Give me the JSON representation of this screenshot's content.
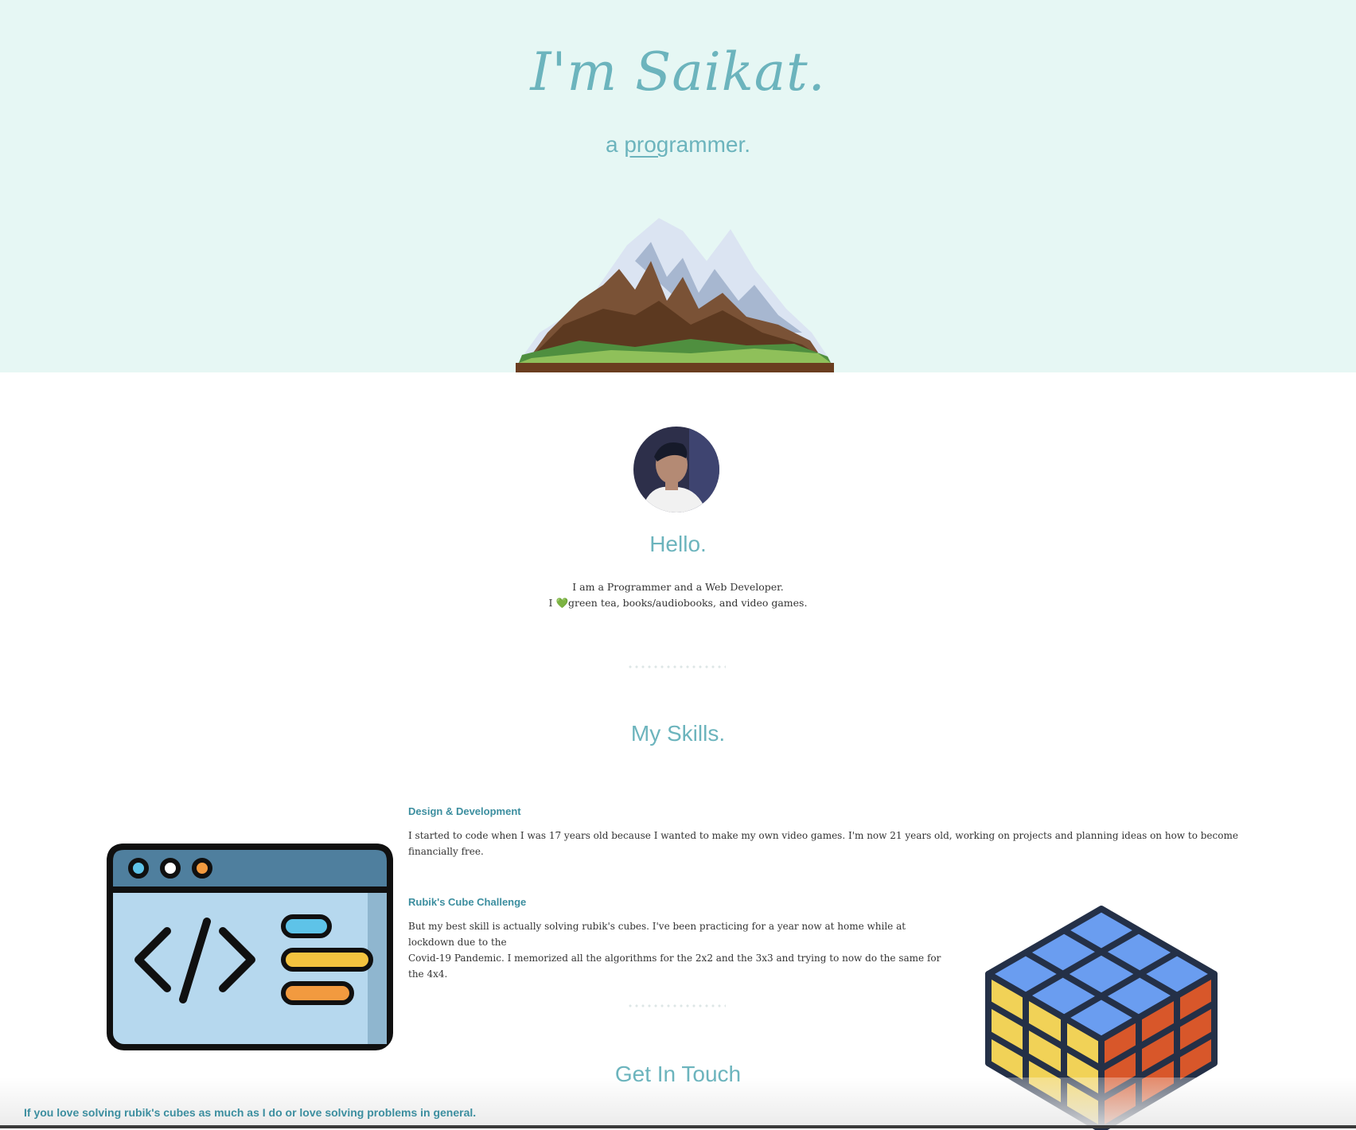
{
  "hero": {
    "title": "I'm Saikat.",
    "subtitle_prefix": "a ",
    "subtitle_underlined": "prog",
    "subtitle_rest": "rammer."
  },
  "about": {
    "heading": "Hello.",
    "line1": "I am a Programmer and a Web Developer.",
    "line2_prefix": "I ",
    "heart": "💚",
    "line2_rest": "green tea, books/audiobooks, and video games."
  },
  "skills": {
    "heading": "My Skills.",
    "items": [
      {
        "title": "Design & Development",
        "text": "I started to code when I was 17 years old because I wanted to make my own video games. I'm now 21 years old, working on projects and planning ideas on how to become financially free."
      },
      {
        "title": "Rubik's Cube Challenge",
        "text_line1": "But my best skill is actually solving rubik's cubes. I've been practicing for a year now at home while at lockdown due to the",
        "text_line2": "Covid-19 Pandemic. I memorized all the algorithms for the 2x2 and the 3x3 and trying to now do the same for the 4x4."
      }
    ]
  },
  "contact": {
    "heading": "Get In Touch",
    "footer_text": "If you love solving rubik's cubes as much as I do or love solving problems in general."
  },
  "icons": {
    "mountain": "mountain-illustration",
    "avatar": "avatar-photo",
    "code": "code-window-icon",
    "cube": "rubiks-cube-icon"
  },
  "colors": {
    "hero_bg": "#e6f7f4",
    "accent": "#6cb4bd",
    "skill_title": "#3c8e9f"
  }
}
